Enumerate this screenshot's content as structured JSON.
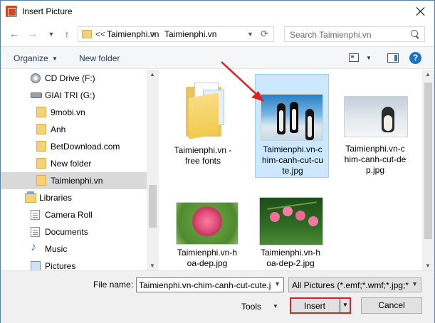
{
  "window": {
    "title": "Insert Picture"
  },
  "address": {
    "prefix": "<<",
    "crumbs": [
      "Taimienphi.vn",
      "Taimienphi.vn"
    ],
    "separator": ">"
  },
  "search": {
    "placeholder": "Search Taimienphi.vn"
  },
  "toolbar": {
    "organize": "Organize",
    "new_folder": "New folder",
    "help": "?"
  },
  "nav": {
    "items": [
      {
        "label": "CD Drive (F:)",
        "icon": "cd-drive-icon"
      },
      {
        "label": "GIAI TRI (G:)",
        "icon": "drive-icon"
      },
      {
        "label": "9mobi.vn",
        "icon": "folder-icon"
      },
      {
        "label": "Anh",
        "icon": "folder-icon"
      },
      {
        "label": "BetDownload.com",
        "icon": "folder-icon"
      },
      {
        "label": "New folder",
        "icon": "folder-icon"
      },
      {
        "label": "Taimienphi.vn",
        "icon": "folder-icon",
        "selected": true
      },
      {
        "label": "Libraries",
        "icon": "libraries-icon"
      },
      {
        "label": "Camera Roll",
        "icon": "library-doc-icon"
      },
      {
        "label": "Documents",
        "icon": "library-doc-icon"
      },
      {
        "label": "Music",
        "icon": "music-icon"
      },
      {
        "label": "Pictures",
        "icon": "pictures-icon"
      }
    ]
  },
  "files": [
    {
      "line1": "Taimienphi.vn -",
      "line2": "free fonts",
      "line3": "",
      "kind": "folder"
    },
    {
      "line1": "Taimienphi.vn-c",
      "line2": "him-canh-cut-cu",
      "line3": "te.jpg",
      "kind": "image",
      "selected": true
    },
    {
      "line1": "Taimienphi.vn-c",
      "line2": "him-canh-cut-de",
      "line3": "p.jpg",
      "kind": "image"
    },
    {
      "line1": "Taimienphi.vn-h",
      "line2": "oa-dep.jpg",
      "line3": "",
      "kind": "image"
    },
    {
      "line1": "Taimienphi.vn-h",
      "line2": "oa-dep-2.jpg",
      "line3": "",
      "kind": "image"
    }
  ],
  "bottom": {
    "file_name_label": "File name:",
    "file_name_value": "Taimienphi.vn-chim-canh-cut-cute.jpg",
    "file_type": "All Pictures (*.emf;*.wmf;*.jpg;*",
    "tools": "Tools",
    "insert": "Insert",
    "cancel": "Cancel"
  },
  "colors": {
    "highlight": "#cce8ff",
    "arrow": "#e02020",
    "accent": "#1a73c7"
  }
}
